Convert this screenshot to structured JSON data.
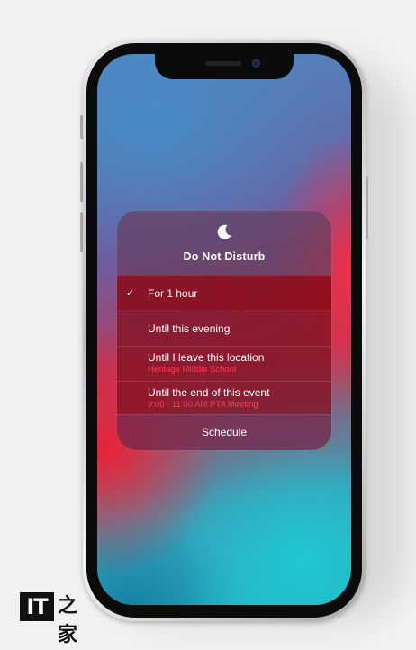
{
  "panel": {
    "icon": "moon-icon",
    "title": "Do Not Disturb",
    "options": [
      {
        "label": "For 1 hour",
        "selected": true
      },
      {
        "label": "Until this evening"
      },
      {
        "label": "Until I leave this location",
        "sublabel": "Heritage Middle School"
      },
      {
        "label": "Until the end of this event",
        "sublabel": "9:00 - 11:00 AM PTA Meeting"
      }
    ],
    "schedule_label": "Schedule",
    "accent_color": "#ff3b55"
  },
  "watermark": {
    "logo_text": "IT",
    "logo_suffix": "之家"
  }
}
